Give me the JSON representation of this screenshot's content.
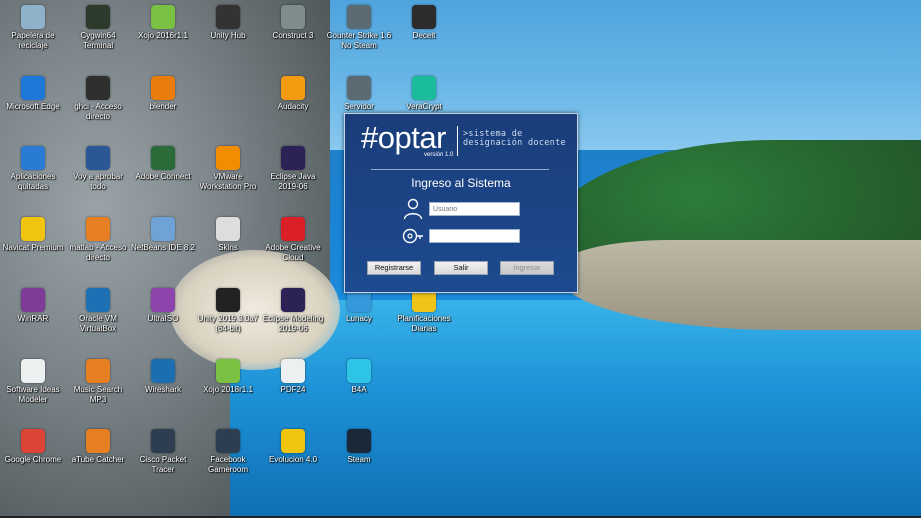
{
  "desktop": {
    "icons": [
      {
        "label": "Papelera de reciclaje",
        "icon": "recycle-bin-icon",
        "color": "#8fb1c9"
      },
      {
        "label": "Cygwin64 Terminal",
        "icon": "terminal-icon",
        "color": "#2b3a2b"
      },
      {
        "label": "Xojo 2016r1.1",
        "icon": "xojo-icon",
        "color": "#7ac143"
      },
      {
        "label": "Unity Hub",
        "icon": "unity-icon",
        "color": "#333333"
      },
      {
        "label": "Construct 3",
        "icon": "construct-icon",
        "color": "#7f8c8d"
      },
      {
        "label": "Counter Strike 1.6 No Steam",
        "icon": "counter-strike-icon",
        "color": "#5c6b73"
      },
      {
        "label": "Deceit",
        "icon": "deceit-icon",
        "color": "#2c2c2c"
      },
      {
        "label": "Microsoft Edge",
        "icon": "edge-icon",
        "color": "#1e78d7"
      },
      {
        "label": "ghci - Acceso directo",
        "icon": "ghci-icon",
        "color": "#2f2f2f"
      },
      {
        "label": "blender",
        "icon": "blender-icon",
        "color": "#e87d0d"
      },
      {
        "label": "Audacity",
        "icon": "audacity-icon",
        "color": "#f39c12"
      },
      {
        "label": "Servidor",
        "icon": "server-icon",
        "color": "#5c6b73"
      },
      {
        "label": "VeraCrypt",
        "icon": "veracrypt-icon",
        "color": "#1abc9c"
      },
      {
        "label": "Aplicaciones quitadas",
        "icon": "document-icon",
        "color": "#2a7bd3"
      },
      {
        "label": "Voy a aprobar todo",
        "icon": "word-icon",
        "color": "#2b5797"
      },
      {
        "label": "Adobe Connect",
        "icon": "adobe-connect-icon",
        "color": "#2b6b3a"
      },
      {
        "label": "VMware Workstation Pro",
        "icon": "vmware-icon",
        "color": "#f28c00"
      },
      {
        "label": "Eclipse Java 2019-06",
        "icon": "eclipse-icon",
        "color": "#2c2255"
      },
      {
        "label": "Navicat Premium",
        "icon": "navicat-icon",
        "color": "#f1c40f"
      },
      {
        "label": "matlab - Acceso directo",
        "icon": "matlab-icon",
        "color": "#e67e22"
      },
      {
        "label": "NetBeans IDE 8.2",
        "icon": "netbeans-icon",
        "color": "#6fa3d8"
      },
      {
        "label": "Skins",
        "icon": "file-icon",
        "color": "#dddddd"
      },
      {
        "label": "Adobe Creative Cloud",
        "icon": "creative-cloud-icon",
        "color": "#da1f26"
      },
      {
        "label": "WinRAR",
        "icon": "winrar-icon",
        "color": "#7d3c98"
      },
      {
        "label": "Oracle VM VirtualBox",
        "icon": "virtualbox-icon",
        "color": "#1f6fb5"
      },
      {
        "label": "UltraISO",
        "icon": "ultraiso-icon",
        "color": "#8e44ad"
      },
      {
        "label": "Unity 2019.3.0a7 (64-bit)",
        "icon": "unity-editor-icon",
        "color": "#222222"
      },
      {
        "label": "Eclipse Modeling 2019-06",
        "icon": "eclipse-modeling-icon",
        "color": "#2c2255"
      },
      {
        "label": "Lunacy",
        "icon": "lunacy-icon",
        "color": "#3498db"
      },
      {
        "label": "Planificaciones Diarias",
        "icon": "planning-doc-icon",
        "color": "#f0c419"
      },
      {
        "label": "Software Ideas Modeler",
        "icon": "ideas-modeler-icon",
        "color": "#ecf0f1"
      },
      {
        "label": "Music Search MP3",
        "icon": "music-search-icon",
        "color": "#e67e22"
      },
      {
        "label": "Wireshark",
        "icon": "wireshark-icon",
        "color": "#1b6fb0"
      },
      {
        "label": "Xojo 2018r1.1",
        "icon": "xojo-icon",
        "color": "#7ac143"
      },
      {
        "label": "PDF24",
        "icon": "pdf24-icon",
        "color": "#ecf0f1"
      },
      {
        "label": "B4A",
        "icon": "b4a-icon",
        "color": "#2ec4e6"
      },
      {
        "label": "Google Chrome",
        "icon": "chrome-icon",
        "color": "#db4437"
      },
      {
        "label": "aTube Catcher",
        "icon": "atube-icon",
        "color": "#e67e22"
      },
      {
        "label": "Cisco Packet Tracer",
        "icon": "packet-tracer-icon",
        "color": "#2c3e50"
      },
      {
        "label": "Facebook Gameroom",
        "icon": "gameroom-icon",
        "color": "#2c3e50"
      },
      {
        "label": "Evolucion 4.0",
        "icon": "evolucion-icon",
        "color": "#f1c40f"
      },
      {
        "label": "Steam",
        "icon": "steam-icon",
        "color": "#1b2838"
      }
    ]
  },
  "dialog": {
    "logo": "#optar",
    "version": "versión 1.0",
    "subtitle_line1": ">sistema de",
    "subtitle_line2": "designación docente",
    "heading": "Ingreso al Sistema",
    "username_placeholder": "Usuario",
    "password_value": "",
    "buttons": {
      "register": "Registrarse",
      "exit": "Salir",
      "login": "Ingresar"
    },
    "colors": {
      "background": "#1d4a8f",
      "border": "#c8d4e6"
    }
  }
}
